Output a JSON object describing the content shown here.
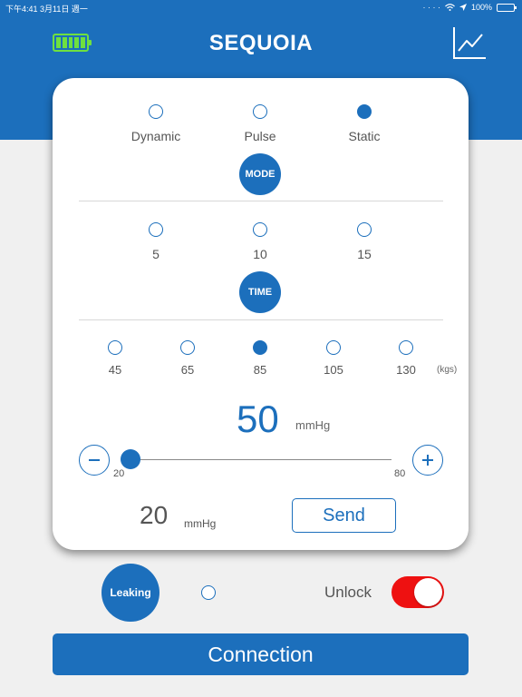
{
  "status_bar": {
    "left": "下午4:41   3月11日 週一",
    "right": "100%"
  },
  "header": {
    "title": "SEQUOIA",
    "battery_level": 1.0,
    "battery_color": "#6ee040",
    "chart_icon": "line-chart-icon"
  },
  "mode": {
    "options": [
      "Dynamic",
      "Pulse",
      "Static"
    ],
    "selected": "Static",
    "button_label": "MODE"
  },
  "time": {
    "options": [
      "5",
      "10",
      "15"
    ],
    "selected": "",
    "button_label": "TIME"
  },
  "weight": {
    "options": [
      "45",
      "65",
      "85",
      "105",
      "130"
    ],
    "selected": "85",
    "unit": "(kgs)"
  },
  "pressure": {
    "target_value": "50",
    "target_unit": "mmHg",
    "slider_min": "20",
    "slider_max": "80",
    "slider_value": 20,
    "actual_value": "20",
    "actual_unit": "mmHg",
    "send_label": "Send"
  },
  "bottom": {
    "leaking_label": "Leaking",
    "unlock_label": "Unlock",
    "unlock_on": true,
    "connection_label": "Connection"
  },
  "colors": {
    "accent": "#1c6fbc",
    "toggle_on": "#ee1111"
  }
}
